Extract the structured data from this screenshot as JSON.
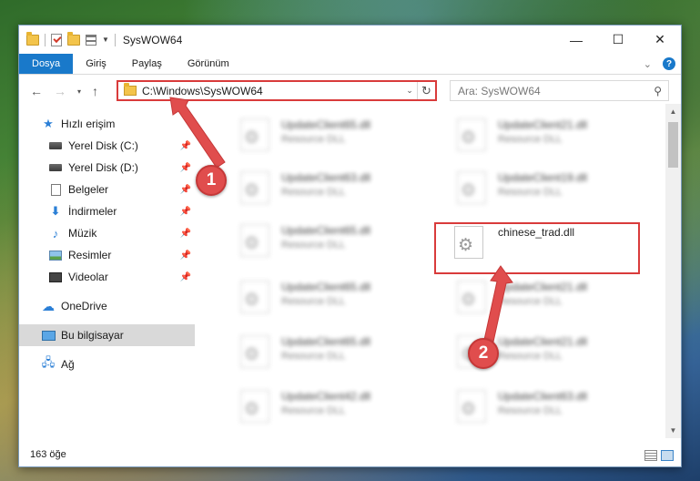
{
  "window": {
    "title": "SysWOW64",
    "controls": {
      "minimize": "—",
      "maximize": "☐",
      "close": "✕"
    }
  },
  "ribbon": {
    "tabs": [
      {
        "label": "Dosya",
        "active": true
      },
      {
        "label": "Giriş",
        "active": false
      },
      {
        "label": "Paylaş",
        "active": false
      },
      {
        "label": "Görünüm",
        "active": false
      }
    ],
    "help": "?"
  },
  "nav": {
    "back": "←",
    "forward": "→",
    "recent": "▾",
    "up": "↑",
    "address": "C:\\Windows\\SysWOW64",
    "search_placeholder": "Ara: SysWOW64"
  },
  "sidebar": {
    "items": [
      {
        "label": "Hızlı erişim",
        "icon": "star-icon",
        "pinned": false
      },
      {
        "label": "Yerel Disk (C:)",
        "icon": "drive-icon",
        "pinned": true
      },
      {
        "label": "Yerel Disk (D:)",
        "icon": "drive-icon",
        "pinned": true
      },
      {
        "label": "Belgeler",
        "icon": "documents-icon",
        "pinned": true
      },
      {
        "label": "İndirmeler",
        "icon": "download-icon",
        "pinned": true
      },
      {
        "label": "Müzik",
        "icon": "music-icon",
        "pinned": true
      },
      {
        "label": "Resimler",
        "icon": "pictures-icon",
        "pinned": true
      },
      {
        "label": "Videolar",
        "icon": "videos-icon",
        "pinned": true
      },
      {
        "label": "OneDrive",
        "icon": "onedrive-icon",
        "pinned": false
      },
      {
        "label": "Bu bilgisayar",
        "icon": "computer-icon",
        "pinned": false,
        "selected": true
      },
      {
        "label": "Ağ",
        "icon": "network-icon",
        "pinned": false
      }
    ]
  },
  "files": [
    {
      "name": "UpdateClient65.dll",
      "type": "Resource DLL",
      "blurred": true
    },
    {
      "name": "UpdateClient21.dll",
      "type": "Resource DLL",
      "blurred": true
    },
    {
      "name": "UpdateClient63.dll",
      "type": "Resource DLL",
      "blurred": true
    },
    {
      "name": "UpdateClient19.dll",
      "type": "Resource DLL",
      "blurred": true
    },
    {
      "name": "UpdateClient65.dll",
      "type": "Resource DLL",
      "blurred": true
    },
    {
      "name": "chinese_trad.dll",
      "type": "",
      "blurred": false,
      "highlighted": true
    },
    {
      "name": "UpdateClient65.dll",
      "type": "Resource DLL",
      "blurred": true
    },
    {
      "name": "UpdateClient21.dll",
      "type": "Resource DLL",
      "blurred": true
    },
    {
      "name": "UpdateClient65.dll",
      "type": "Resource DLL",
      "blurred": true
    },
    {
      "name": "UpdateClient21.dll",
      "type": "Resource DLL",
      "blurred": true
    },
    {
      "name": "UpdateClient42.dll",
      "type": "Resource DLL",
      "blurred": true
    },
    {
      "name": "UpdateClient63.dll",
      "type": "Resource DLL",
      "blurred": true
    }
  ],
  "status": {
    "count": "163 öğe"
  },
  "callouts": {
    "one": "1",
    "two": "2"
  },
  "colors": {
    "accent": "#1979ca",
    "annotation": "#d93b3b"
  }
}
